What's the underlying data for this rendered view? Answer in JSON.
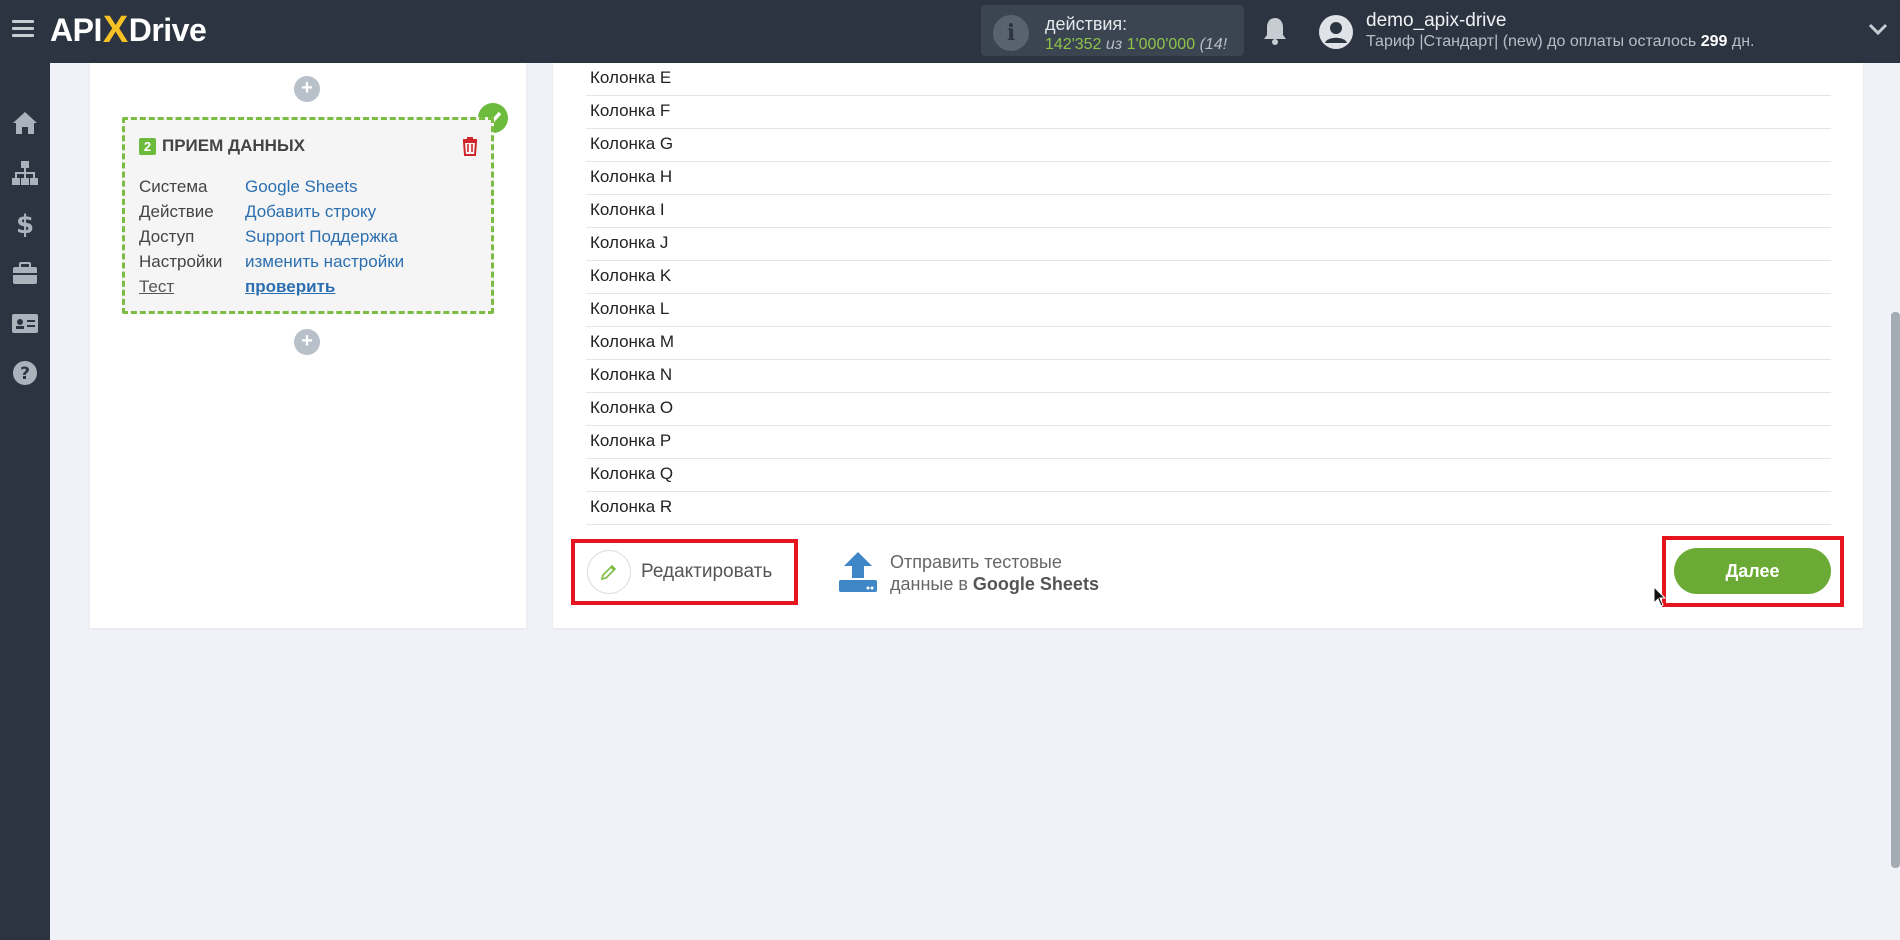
{
  "header": {
    "logo_left": "API",
    "logo_x": "X",
    "logo_right": "Drive",
    "actions_label": "действия:",
    "actions_used": "142'352",
    "actions_of": "из",
    "actions_limit": "1'000'000",
    "actions_rest": "(14!",
    "username": "demo_apix-drive",
    "plan_text": "Тариф |Стандарт| (new) до оплаты осталось",
    "plan_days": "299",
    "plan_days_unit": "дн."
  },
  "sidebar": {
    "icons": [
      "home-icon",
      "sitemap-icon",
      "dollar-icon",
      "briefcase-icon",
      "id-card-icon",
      "help-icon"
    ]
  },
  "step": {
    "number": "2",
    "title": "ПРИЕМ ДАННЫХ",
    "rows": [
      {
        "key": "Система",
        "value": "Google Sheets"
      },
      {
        "key": "Действие",
        "value": "Добавить строку"
      },
      {
        "key": "Доступ",
        "value": "Support Поддержка"
      },
      {
        "key": "Настройки",
        "value": "изменить настройки"
      },
      {
        "key": "Тест",
        "value": "проверить"
      }
    ]
  },
  "columns": [
    "Колонка E",
    "Колонка F",
    "Колонка G",
    "Колонка H",
    "Колонка I",
    "Колонка J",
    "Колонка K",
    "Колонка L",
    "Колонка M",
    "Колонка N",
    "Колонка O",
    "Колонка P",
    "Колонка Q",
    "Колонка R"
  ],
  "buttons": {
    "edit": "Редактировать",
    "send_line1": "Отправить тестовые",
    "send_line2_prefix": "данные в",
    "send_line2_bold": "Google Sheets",
    "next": "Далее"
  },
  "colors": {
    "topbar": "#2b3440",
    "accent_green": "#6aaa35",
    "highlight_red": "#e4151f",
    "link_blue": "#2c6fb0"
  }
}
